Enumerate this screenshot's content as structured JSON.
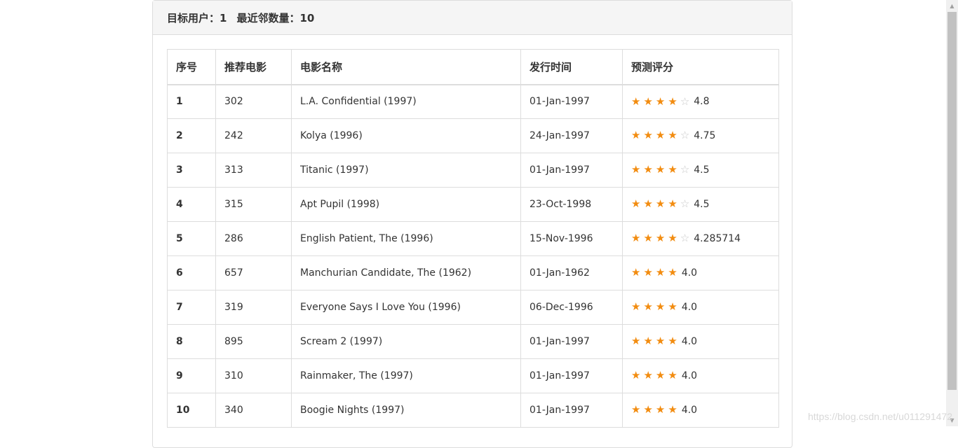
{
  "header": {
    "target_user_label": "目标用户：",
    "target_user_value": "1",
    "neighbors_label": "最近邻数量：",
    "neighbors_value": "10"
  },
  "table": {
    "columns": [
      "序号",
      "推荐电影",
      "电影名称",
      "发行时间",
      "预测评分"
    ],
    "rows": [
      {
        "idx": "1",
        "movie_id": "302",
        "title": "L.A. Confidential (1997)",
        "release": "01-Jan-1997",
        "stars_filled": 4,
        "stars_empty": 1,
        "rating": "4.8"
      },
      {
        "idx": "2",
        "movie_id": "242",
        "title": "Kolya (1996)",
        "release": "24-Jan-1997",
        "stars_filled": 4,
        "stars_empty": 1,
        "rating": "4.75"
      },
      {
        "idx": "3",
        "movie_id": "313",
        "title": "Titanic (1997)",
        "release": "01-Jan-1997",
        "stars_filled": 4,
        "stars_empty": 1,
        "rating": "4.5"
      },
      {
        "idx": "4",
        "movie_id": "315",
        "title": "Apt Pupil (1998)",
        "release": "23-Oct-1998",
        "stars_filled": 4,
        "stars_empty": 1,
        "rating": "4.5"
      },
      {
        "idx": "5",
        "movie_id": "286",
        "title": "English Patient, The (1996)",
        "release": "15-Nov-1996",
        "stars_filled": 4,
        "stars_empty": 1,
        "rating": "4.285714"
      },
      {
        "idx": "6",
        "movie_id": "657",
        "title": "Manchurian Candidate, The (1962)",
        "release": "01-Jan-1962",
        "stars_filled": 4,
        "stars_empty": 0,
        "rating": "4.0"
      },
      {
        "idx": "7",
        "movie_id": "319",
        "title": "Everyone Says I Love You (1996)",
        "release": "06-Dec-1996",
        "stars_filled": 4,
        "stars_empty": 0,
        "rating": "4.0"
      },
      {
        "idx": "8",
        "movie_id": "895",
        "title": "Scream 2 (1997)",
        "release": "01-Jan-1997",
        "stars_filled": 4,
        "stars_empty": 0,
        "rating": "4.0"
      },
      {
        "idx": "9",
        "movie_id": "310",
        "title": "Rainmaker, The (1997)",
        "release": "01-Jan-1997",
        "stars_filled": 4,
        "stars_empty": 0,
        "rating": "4.0"
      },
      {
        "idx": "10",
        "movie_id": "340",
        "title": "Boogie Nights (1997)",
        "release": "01-Jan-1997",
        "stars_filled": 4,
        "stars_empty": 0,
        "rating": "4.0"
      }
    ]
  },
  "icons": {
    "star_filled": "star-filled-icon",
    "star_empty": "star-empty-icon"
  },
  "colors": {
    "star": "#f28c10",
    "star_empty": "#c8c8c8",
    "border": "#dddddd",
    "heading_bg": "#f5f5f5"
  },
  "watermark": "https://blog.csdn.net/u011291472"
}
